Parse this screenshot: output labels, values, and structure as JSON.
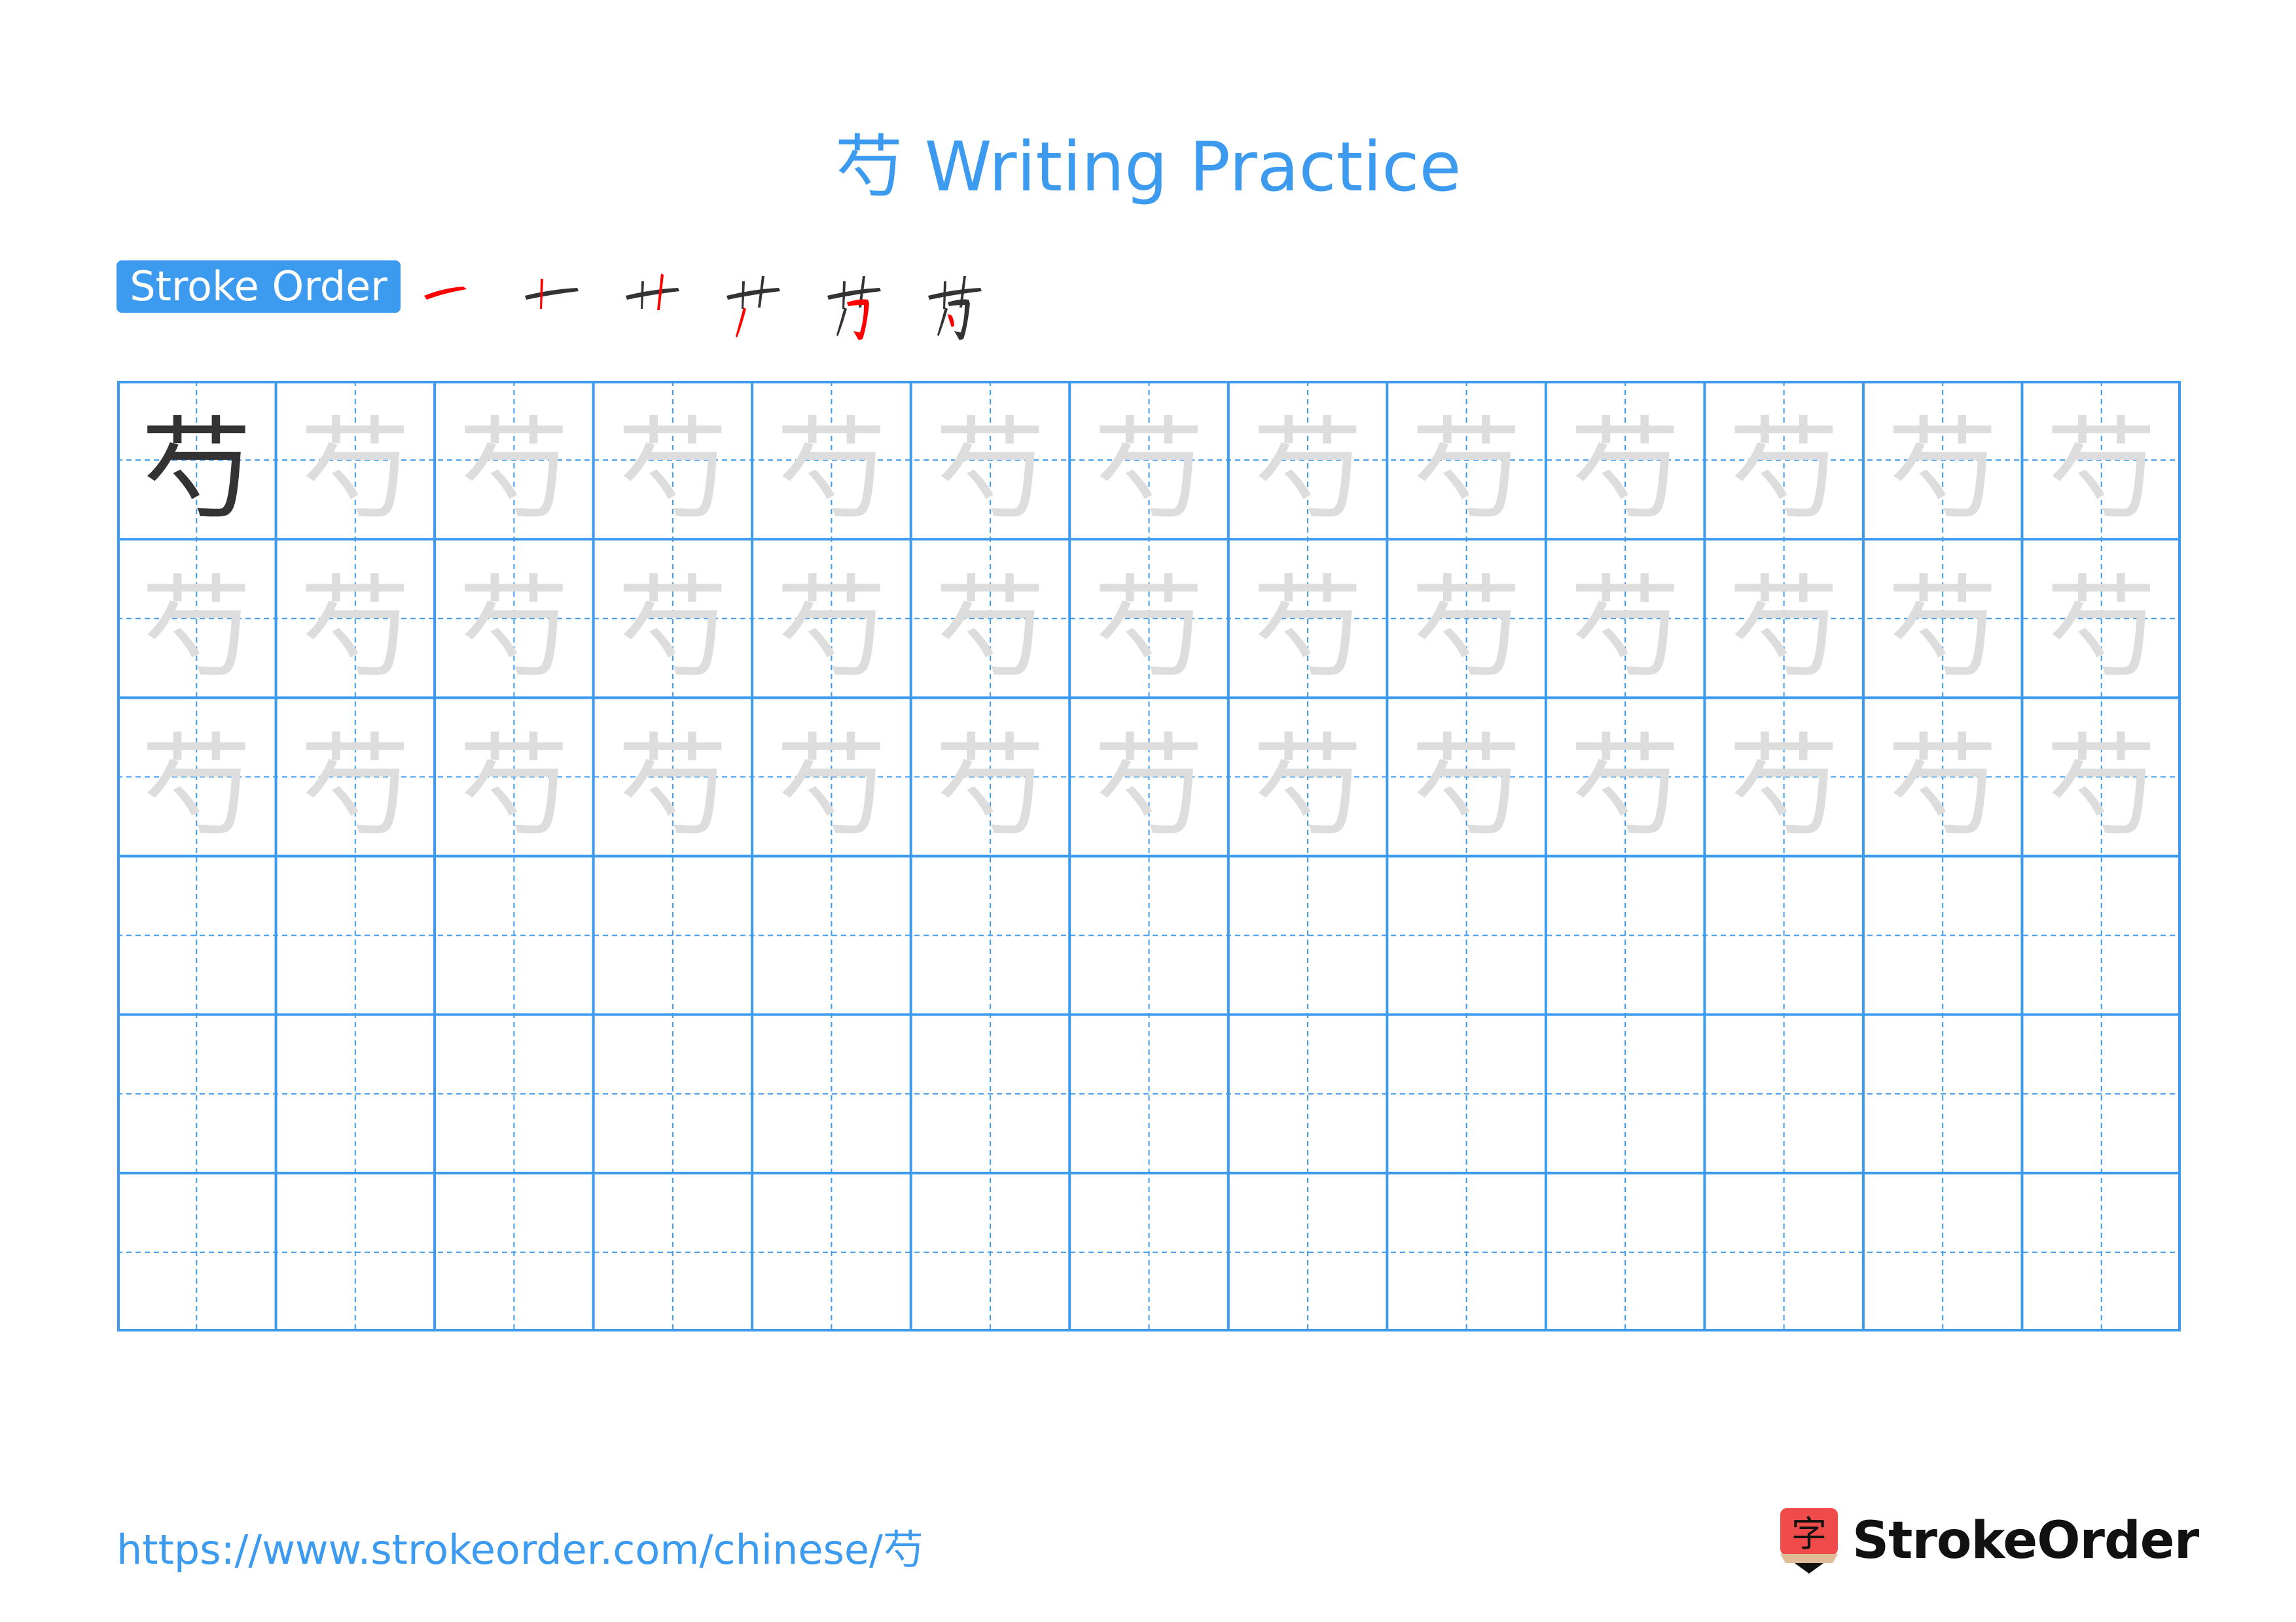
{
  "title": "芍 Writing Practice",
  "character": "芍",
  "stroke_order": {
    "label": "Stroke Order",
    "steps": [
      "一",
      "十",
      "廾",
      "艹",
      "芍",
      "芍"
    ],
    "step_count": 6
  },
  "grid": {
    "columns": 13,
    "rows": 6,
    "model_cells": 1,
    "trace_rows": 3,
    "blank_rows": 3,
    "colors": {
      "line": "#3d9bef",
      "model_char": "#333333",
      "trace_char": "#dddddd",
      "highlight": "#ff0000"
    }
  },
  "footer": {
    "url": "https://www.strokeorder.com/chinese/芍",
    "logo_text": "StrokeOrder",
    "logo_icon_char": "字"
  }
}
